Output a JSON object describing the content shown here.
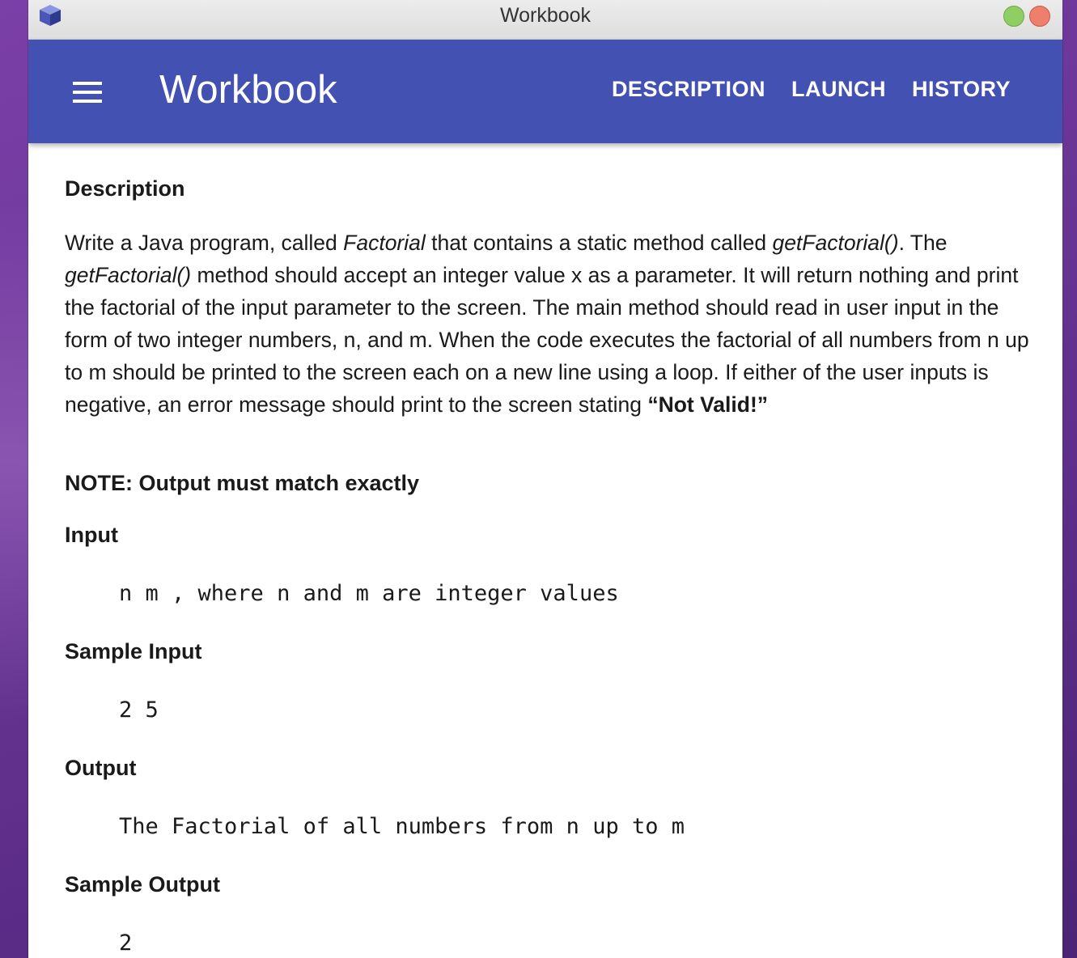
{
  "window": {
    "title": "Workbook"
  },
  "appbar": {
    "title": "Workbook",
    "nav": [
      {
        "label": "DESCRIPTION"
      },
      {
        "label": "LAUNCH"
      },
      {
        "label": "HISTORY"
      }
    ]
  },
  "content": {
    "description_heading": "Description",
    "paragraph": {
      "t1": "Write a Java program, called ",
      "i1": "Factorial",
      "t2": " that contains a static method called ",
      "i2": "getFactorial()",
      "t3": ". The ",
      "i3": "getFactorial()",
      "t4": " method should accept an integer value x as a parameter. It will return nothing and print the factorial of the input parameter to the screen. The main method should read in user input in the form of two integer numbers, n, and m. When the code executes the factorial of all numbers from n up to m should be printed to the screen each on a new line using a loop. If either of the user inputs is negative, an error message should print to the screen stating ",
      "b1": "“Not Valid!”"
    },
    "note": "NOTE: Output must match exactly",
    "input_heading": "Input",
    "input_code": "n m , where n and m are integer values",
    "sample_input_heading": "Sample Input",
    "sample_input_code": "2 5",
    "output_heading": "Output",
    "output_code": "The Factorial of all numbers from n up to m",
    "sample_output_heading": "Sample Output",
    "sample_output_code": "2"
  },
  "colors": {
    "appbar": "#4351b2",
    "desktop": "#6a3696"
  }
}
